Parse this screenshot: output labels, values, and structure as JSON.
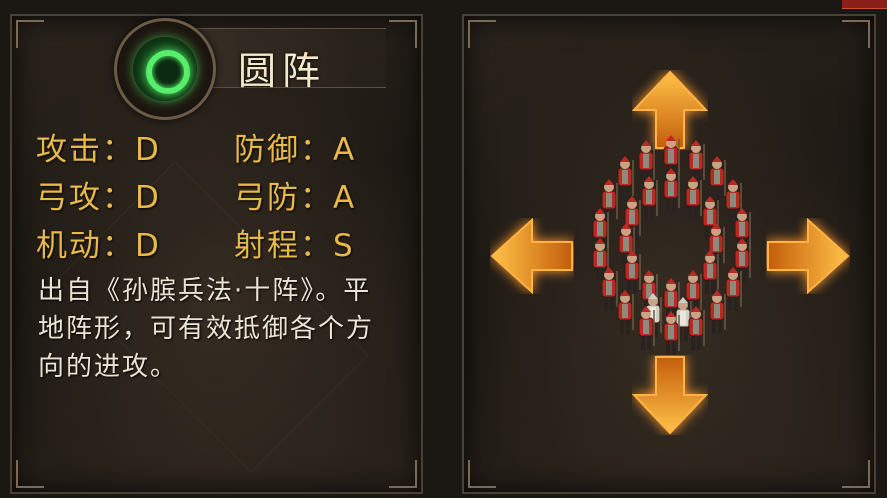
{
  "formation": {
    "name": "圆阵",
    "emblem_icon": "green-ring-icon"
  },
  "stats": {
    "attack": {
      "label": "攻击：",
      "value": "D"
    },
    "defense": {
      "label": "防御：",
      "value": "A"
    },
    "bow_attack": {
      "label": "弓攻：",
      "value": "D"
    },
    "bow_defense": {
      "label": "弓防：",
      "value": "A"
    },
    "mobility": {
      "label": "机动：",
      "value": "D"
    },
    "range": {
      "label": "射程：",
      "value": "S"
    }
  },
  "description": "出自《孙膑兵法·十阵》。平地阵形，可有效抵御各个方向的进攻。",
  "preview": {
    "arrows": [
      "arrow-up-icon",
      "arrow-down-icon",
      "arrow-left-icon",
      "arrow-right-icon"
    ],
    "arrow_color": "#f39a1e",
    "soldier_color": "#b82a22",
    "general_color": "#cfcfc4"
  },
  "colors": {
    "stat_text": "#e7b949",
    "title_text": "#f4e8c9",
    "desc_text": "#ece4d3"
  }
}
